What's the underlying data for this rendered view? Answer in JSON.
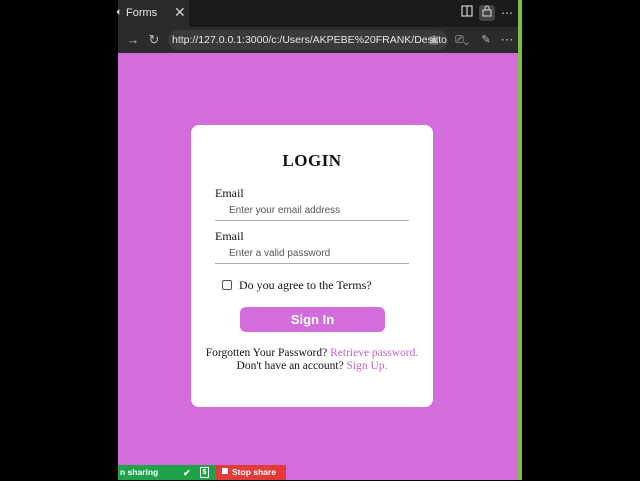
{
  "browser": {
    "tab_title": "Forms",
    "tab_icon": "globe-icon",
    "url": "http://127.0.0.1:3000/c:/Users/AKPEBE%20FRANK/Deskto...",
    "colors": {
      "chrome": "#2b2b2b",
      "page_bg": "#d26ddb"
    }
  },
  "form": {
    "title": "LOGIN",
    "email_label": "Email",
    "email_placeholder": "Enter your email address",
    "password_label": "Email",
    "password_placeholder": "Enter a valid password",
    "terms_label": "Do you agree to the Terms?",
    "terms_checked": false,
    "submit_label": "Sign In",
    "forgot_text": "Forgotten Your Password?",
    "forgot_link": "Retrieve password.",
    "signup_text": "Don't have an account?",
    "signup_link": "Sign Up.",
    "accent": "#d26ddb",
    "link_color": "#c264c9"
  },
  "share_bar": {
    "sharing_text": "n sharing",
    "stop_text": "Stop share",
    "sharing_color": "#1ea34a",
    "stop_color": "#e23b3b"
  }
}
